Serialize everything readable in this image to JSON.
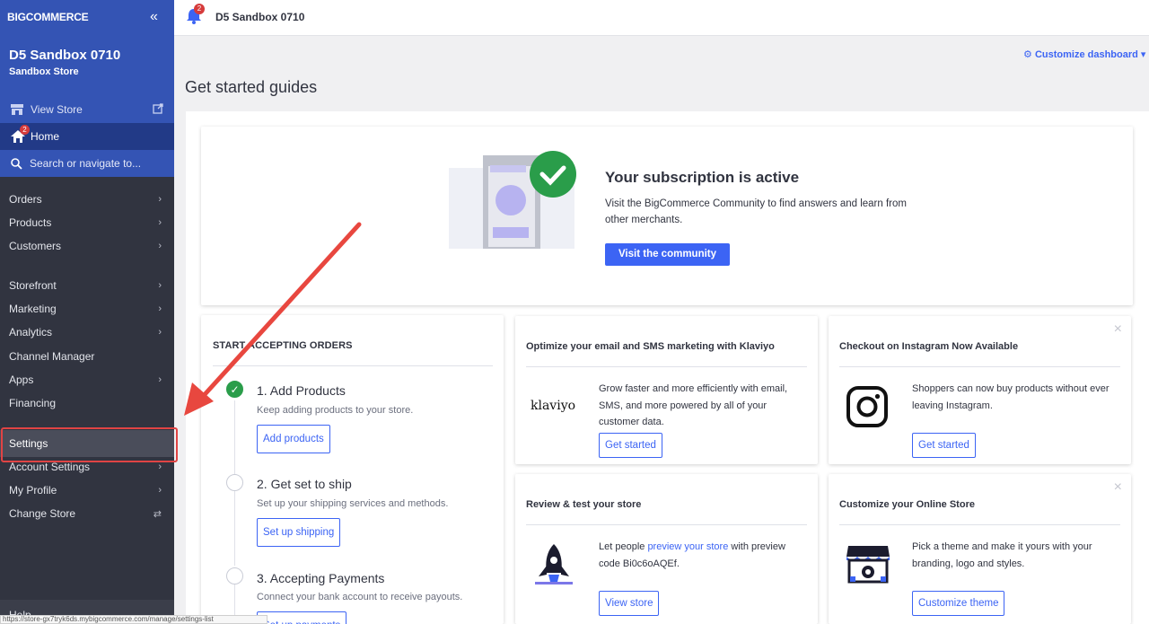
{
  "sidebar": {
    "logo_big": "BIG",
    "logo_commerce": "COMMERCE",
    "collapse_label": "«",
    "store_name": "D5 Sandbox 0710",
    "store_type": "Sandbox Store",
    "view_store": "View Store",
    "home": "Home",
    "home_badge": "2",
    "search_placeholder": "Search or navigate to...",
    "items": [
      {
        "label": "Orders",
        "chev": "›"
      },
      {
        "label": "Products",
        "chev": "›"
      },
      {
        "label": "Customers",
        "chev": "›"
      },
      {
        "label": "Storefront",
        "chev": "›"
      },
      {
        "label": "Marketing",
        "chev": "›"
      },
      {
        "label": "Analytics",
        "chev": "›"
      },
      {
        "label": "Channel Manager",
        "chev": ""
      },
      {
        "label": "Apps",
        "chev": "›"
      },
      {
        "label": "Financing",
        "chev": ""
      },
      {
        "label": "Settings",
        "chev": ""
      },
      {
        "label": "Account Settings",
        "chev": "›"
      },
      {
        "label": "My Profile",
        "chev": "›"
      },
      {
        "label": "Change Store",
        "chev": "⇄"
      }
    ],
    "help": "Help",
    "status_url": "https://store-gx7tryk6ds.mybigcommerce.com/manage/settings-list"
  },
  "header": {
    "title": "D5 Sandbox 0710",
    "bell_badge": "2"
  },
  "customize_dashboard": "Customize dashboard",
  "page_title": "Get started guides",
  "subscription": {
    "title": "Your subscription is active",
    "description": "Visit the BigCommerce Community to find answers and learn from other merchants.",
    "button": "Visit the community"
  },
  "orders": {
    "heading": "START ACCEPTING ORDERS",
    "steps": [
      {
        "title": "1. Add Products",
        "desc": "Keep adding products to your store.",
        "button": "Add products",
        "done": true
      },
      {
        "title": "2. Get set to ship",
        "desc": "Set up your shipping services and methods.",
        "button": "Set up shipping",
        "done": false
      },
      {
        "title": "3. Accepting Payments",
        "desc": "Connect your bank account to receive payouts.",
        "button": "Set up payments",
        "done": false
      }
    ]
  },
  "promos": {
    "klaviyo": {
      "title": "Optimize your email and SMS marketing with Klaviyo",
      "logo": "klaviyo",
      "text": "Grow faster and more efficiently with email, SMS, and more powered by all of your customer data.",
      "button": "Get started"
    },
    "instagram": {
      "title": "Checkout on Instagram Now Available",
      "text": "Shoppers can now buy products without ever leaving Instagram.",
      "button": "Get started",
      "close": "×"
    },
    "review": {
      "title": "Review & test your store",
      "text_before": "Let people ",
      "link": "preview your store",
      "text_after": " with preview code Bi0c6oAQEf.",
      "button": "View store"
    },
    "customize": {
      "title": "Customize your Online Store",
      "text": "Pick a theme and make it yours with your branding, logo and styles.",
      "button": "Customize theme",
      "close": "×"
    }
  },
  "colors": {
    "sidebar_bg": "#313440",
    "sidebar_top": "#3454b4",
    "accent": "#3c64f4",
    "highlight": "#e04444",
    "success": "#2a9d4a"
  }
}
